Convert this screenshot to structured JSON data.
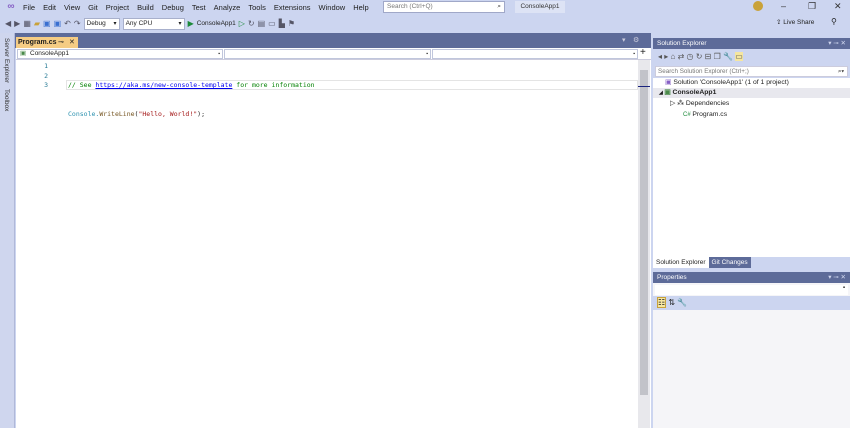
{
  "menu": {
    "items": [
      "File",
      "Edit",
      "View",
      "Git",
      "Project",
      "Build",
      "Debug",
      "Test",
      "Analyze",
      "Tools",
      "Extensions",
      "Window",
      "Help"
    ],
    "search_placeholder": "Search (Ctrl+Q)",
    "solution_name": "ConsoleApp1"
  },
  "toolbar": {
    "config": "Debug",
    "platform": "Any CPU",
    "start": "ConsoleApp1",
    "live_share": "Live Share"
  },
  "side": {
    "server_explorer": "Server Explorer",
    "toolbox": "Toolbox"
  },
  "editor": {
    "tab": "Program.cs",
    "nav_project": "ConsoleApp1",
    "line_numbers": [
      "1",
      "2",
      "3"
    ],
    "line1_comment": "// See ",
    "line1_link": "https://aka.ms/new-console-template",
    "line1_rest": " for more information",
    "line2_a": "Console.",
    "line2_b": "WriteLine",
    "line2_c": "(",
    "line2_str": "\"Hello, World!\"",
    "line2_d": ");"
  },
  "solution_explorer": {
    "title": "Solution Explorer",
    "search_placeholder": "Search Solution Explorer (Ctrl+;)",
    "solution": "Solution 'ConsoleApp1' (1 of 1 project)",
    "project": "ConsoleApp1",
    "dependencies": "Dependencies",
    "file": "Program.cs",
    "tabs": [
      "Solution Explorer",
      "Git Changes"
    ]
  },
  "properties": {
    "title": "Properties"
  }
}
